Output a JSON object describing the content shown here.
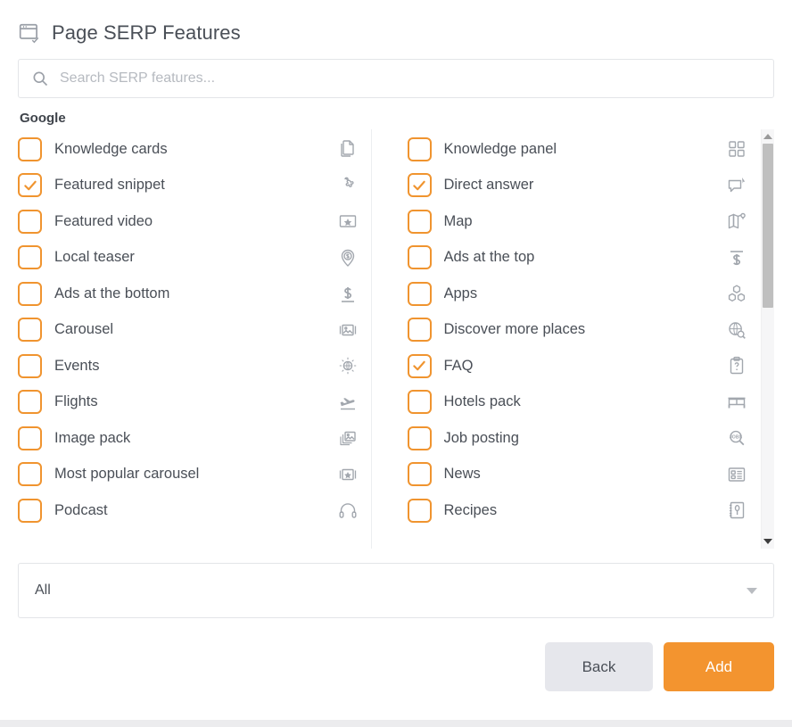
{
  "header": {
    "title": "Page SERP Features",
    "icon": "browser-check-icon"
  },
  "search": {
    "placeholder": "Search SERP features...",
    "value": "",
    "icon": "search-icon"
  },
  "group": {
    "label": "Google"
  },
  "columns": {
    "left": [
      {
        "label": "Knowledge cards",
        "checked": false,
        "icon": "copy-documents-icon"
      },
      {
        "label": "Featured snippet",
        "checked": true,
        "icon": "puzzle-piece-icon"
      },
      {
        "label": "Featured video",
        "checked": false,
        "icon": "star-in-box-icon"
      },
      {
        "label": "Local teaser",
        "checked": false,
        "icon": "dollar-pin-icon"
      },
      {
        "label": "Ads at the bottom",
        "checked": false,
        "icon": "dollar-underline-icon"
      },
      {
        "label": "Carousel",
        "checked": false,
        "icon": "image-carousel-icon"
      },
      {
        "label": "Events",
        "checked": false,
        "icon": "disco-globe-icon"
      },
      {
        "label": "Flights",
        "checked": false,
        "icon": "airplane-icon"
      },
      {
        "label": "Image pack",
        "checked": false,
        "icon": "image-stack-icon"
      },
      {
        "label": "Most popular carousel",
        "checked": false,
        "icon": "star-carousel-icon"
      },
      {
        "label": "Podcast",
        "checked": false,
        "icon": "headphones-icon"
      }
    ],
    "right": [
      {
        "label": "Knowledge panel",
        "checked": false,
        "icon": "grid-squares-icon"
      },
      {
        "label": "Direct answer",
        "checked": true,
        "icon": "speech-bubble-cursor-icon"
      },
      {
        "label": "Map",
        "checked": false,
        "icon": "map-pin-icon"
      },
      {
        "label": "Ads at the top",
        "checked": false,
        "icon": "dollar-overline-icon"
      },
      {
        "label": "Apps",
        "checked": false,
        "icon": "cubes-icon"
      },
      {
        "label": "Discover more places",
        "checked": false,
        "icon": "globe-search-icon"
      },
      {
        "label": "FAQ",
        "checked": true,
        "icon": "clipboard-question-icon"
      },
      {
        "label": "Hotels pack",
        "checked": false,
        "icon": "bed-icon"
      },
      {
        "label": "Job posting",
        "checked": false,
        "icon": "jobs-search-icon"
      },
      {
        "label": "News",
        "checked": false,
        "icon": "news-article-icon"
      },
      {
        "label": "Recipes",
        "checked": false,
        "icon": "recipe-book-icon"
      }
    ]
  },
  "filter_select": {
    "value": "All",
    "caret_icon": "chevron-down-icon"
  },
  "footer": {
    "back_label": "Back",
    "add_label": "Add"
  },
  "colors": {
    "accent": "#f3942f",
    "checkbox_border": "#f0942f",
    "text": "#4a4f57",
    "icon_gray": "#9ba0a8",
    "back_button_bg": "#e6e7ec"
  },
  "scrollbar": {
    "up_icon": "triangle-up-icon",
    "down_icon": "triangle-down-icon"
  }
}
